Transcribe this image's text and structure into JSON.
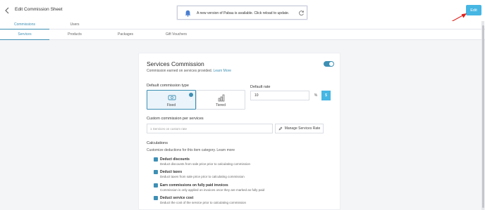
{
  "header": {
    "title": "Edit Commission Sheet",
    "edit_label": "Edit",
    "back_icon": "chevron-left-icon"
  },
  "toast": {
    "message": "A new version of Pabau is available. Click reload to update.",
    "bell_icon": "bell-icon",
    "reload_icon": "reload-icon"
  },
  "top_tabs": [
    {
      "label": "Commissions",
      "active": true
    },
    {
      "label": "Users",
      "active": false
    }
  ],
  "sub_tabs": [
    {
      "label": "Services",
      "active": true
    },
    {
      "label": "Products",
      "active": false
    },
    {
      "label": "Packages",
      "active": false
    },
    {
      "label": "Gift Vouchers",
      "active": false
    }
  ],
  "services_commission": {
    "title": "Services Commission",
    "subtitle": "Commission earned on services provided.",
    "learn_more": "Learn More",
    "enabled": true
  },
  "default_commission_type": {
    "label": "Default commission type",
    "options": [
      {
        "label": "Fixed",
        "selected": true
      },
      {
        "label": "Tiered",
        "selected": false
      }
    ]
  },
  "default_rate": {
    "label": "Default rate",
    "value": "10",
    "percent_label": "%",
    "dollar_label": "$"
  },
  "custom_per_service": {
    "label": "Custom commission per services",
    "placeholder": "1 Services on custom rate",
    "manage_label": "Manage Services Rate"
  },
  "calculations": {
    "title": "Calculations",
    "subtitle": "Customize deductions for this item category.",
    "learn_more": "Learn more",
    "items": [
      {
        "title": "Deduct discounts",
        "desc": "Deduct discounts from sale price prior to calculating commission",
        "checked": true
      },
      {
        "title": "Deduct taxes",
        "desc": "Deduct taxes from sale price prior to calculating commission",
        "checked": true
      },
      {
        "title": "Earn commissions on fully paid invoices",
        "desc": "Commission is only applied on invoices once they are marked as fully paid",
        "checked": true
      },
      {
        "title": "Deduct service cost",
        "desc": "Deduct the cost of the service prior to calculating commission",
        "checked": true
      }
    ]
  },
  "colors": {
    "accent": "#3e8fb4",
    "edit_button": "#46b6e3",
    "arrow": "#e0201b"
  }
}
